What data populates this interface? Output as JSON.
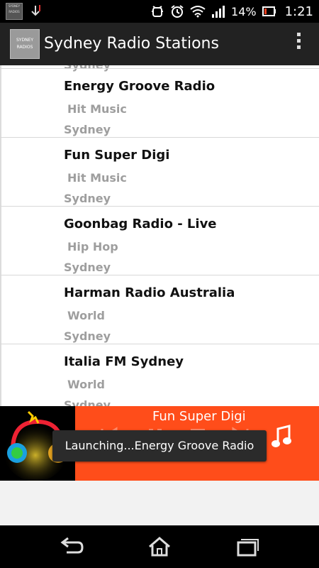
{
  "status_bar": {
    "app_thumb_text": "SYDNEY RADIOS",
    "battery_percent": "14%",
    "time": "1:21"
  },
  "action_bar": {
    "logo_text": "SYDNEY RADIOS",
    "title": "Sydney Radio Stations"
  },
  "list": {
    "peek_text": "Sydney",
    "stations": [
      {
        "name": "Energy Groove Radio",
        "genre": "Hit Music",
        "city": "Sydney"
      },
      {
        "name": "Fun Super Digi",
        "genre": "Hit Music",
        "city": "Sydney"
      },
      {
        "name": "Goonbag Radio - Live",
        "genre": "Hip Hop",
        "city": "Sydney"
      },
      {
        "name": "Harman Radio Australia",
        "genre": "World",
        "city": "Sydney"
      },
      {
        "name": "Italia FM Sydney",
        "genre": "World",
        "city": "Sydney"
      }
    ]
  },
  "player": {
    "now_playing": "Fun Super Digi",
    "accent_color": "#ff4d1a"
  },
  "toast": {
    "message": "Launching...Energy Groove Radio"
  }
}
